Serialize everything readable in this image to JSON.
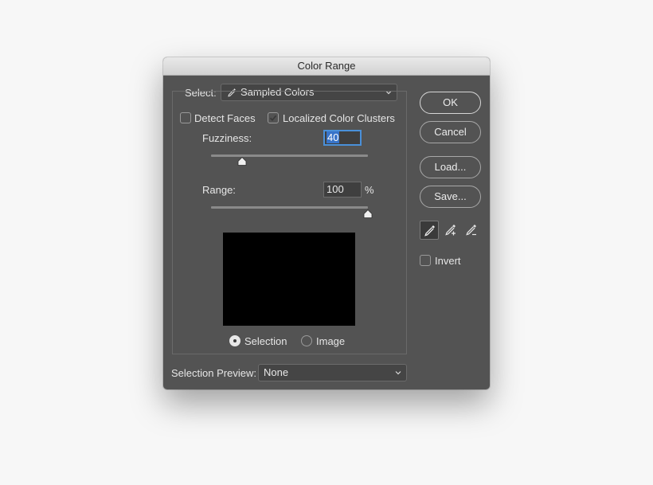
{
  "dialog": {
    "title": "Color Range",
    "select_label": "Select:",
    "select_value": "Sampled Colors",
    "detect_faces": {
      "label": "Detect Faces",
      "checked": false
    },
    "localized_clusters": {
      "label": "Localized Color Clusters",
      "checked": true
    },
    "fuzziness": {
      "label": "Fuzziness:",
      "value": "40",
      "slider_max": 200
    },
    "range": {
      "label": "Range:",
      "value": "100",
      "unit": "%",
      "slider_max": 100
    },
    "preview_mode": {
      "selection_label": "Selection",
      "image_label": "Image",
      "selected": "Selection"
    },
    "selection_preview_label": "Selection Preview:",
    "selection_preview_value": "None",
    "buttons": {
      "ok": "OK",
      "cancel": "Cancel",
      "load": "Load...",
      "save": "Save..."
    },
    "tools": [
      "eyedropper-icon",
      "eyedropper-plus-icon",
      "eyedropper-minus-icon"
    ],
    "active_tool": "eyedropper-icon",
    "invert": {
      "label": "Invert",
      "checked": false
    }
  },
  "colors": {
    "panel": "#535353",
    "titlebar": "#dedede",
    "focus_accent": "#4a90d9",
    "preview_bg": "#000000"
  }
}
